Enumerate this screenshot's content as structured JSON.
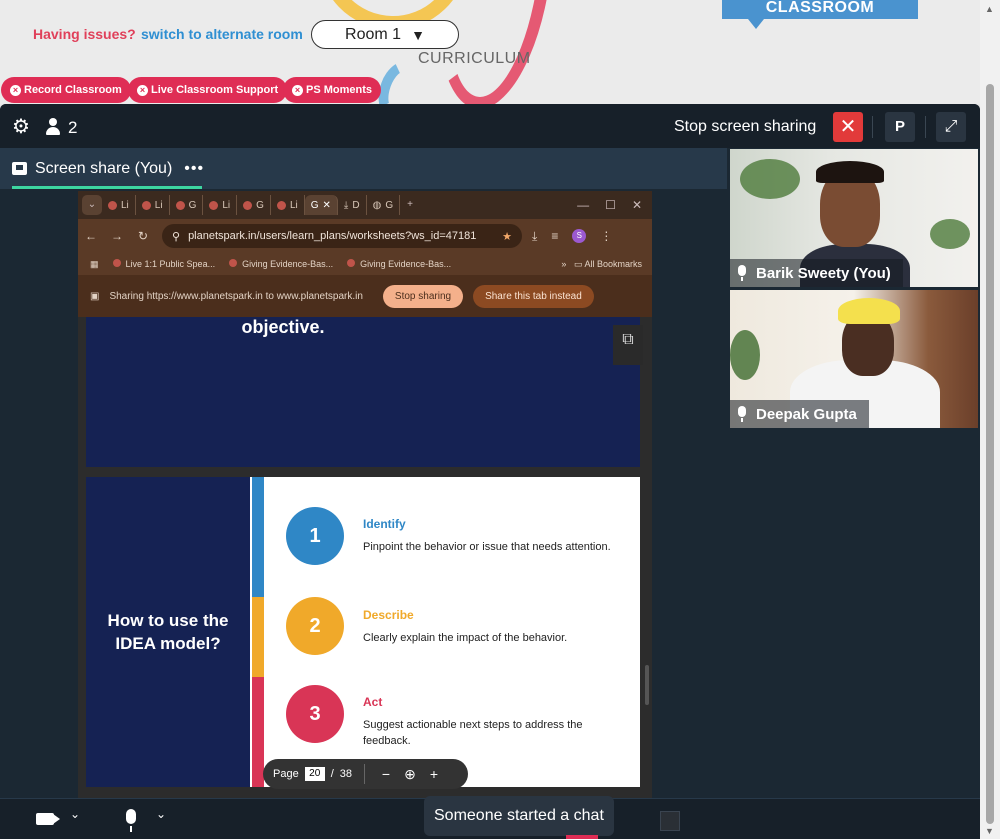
{
  "header": {
    "classroom_tab": "CLASSROOM",
    "issues_text": "Having issues?",
    "switch_room_link": "switch to alternate room",
    "room_select_value": "Room 1",
    "curriculum_label": "CURRICULUM",
    "colors": {
      "accent_red": "#df2d55",
      "link_blue": "#2f8fd2",
      "tab_blue": "#4a93cf"
    }
  },
  "action_buttons": [
    {
      "label": "Record Classroom"
    },
    {
      "label": "Live Classroom Support"
    },
    {
      "label": "PS Moments"
    }
  ],
  "meeting": {
    "participant_count": "2",
    "stop_sharing_label": "Stop screen sharing",
    "p_button_label": "P",
    "share_tab_label": "Screen share (You)",
    "share_tab_more": "•••"
  },
  "shared_screen": {
    "tabs": [
      {
        "label": "Li"
      },
      {
        "label": "Li"
      },
      {
        "label": "G"
      },
      {
        "label": "Li"
      },
      {
        "label": "G"
      },
      {
        "label": "Li"
      },
      {
        "label": "G",
        "active": true
      },
      {
        "label": "D"
      },
      {
        "label": "G"
      }
    ],
    "url": "planetspark.in/users/learn_plans/worksheets?ws_id=47181",
    "profile_initial": "S",
    "bookmarks": [
      "Live 1:1 Public Spea...",
      "Giving Evidence-Bas...",
      "Giving Evidence-Bas..."
    ],
    "all_bookmarks": "All Bookmarks",
    "sharing_message": "Sharing https://www.planetspark.in to www.planetspark.in",
    "sharing_stop_button": "Stop sharing",
    "sharing_tab_button": "Share this tab instead",
    "slide": {
      "top_heading": "objective.",
      "title": "How to use the IDEA model?",
      "steps": [
        {
          "number": "1",
          "title": "Identify",
          "description": "Pinpoint the behavior or issue that needs attention.",
          "color": "#2f87c6"
        },
        {
          "number": "2",
          "title": "Describe",
          "description": "Clearly explain the impact of the behavior.",
          "color": "#f0a92a"
        },
        {
          "number": "3",
          "title": "Act",
          "description": "Suggest actionable next steps to address the feedback.",
          "color": "#d93556"
        }
      ]
    },
    "pdf_toolbar": {
      "page_label": "Page",
      "current_page": "20",
      "separator": "/",
      "total_pages": "38"
    }
  },
  "participants": [
    {
      "name": "Barik Sweety (You)"
    },
    {
      "name": "Deepak Gupta"
    }
  ],
  "bottom_bar": {
    "chat_toast": "Someone started a chat"
  }
}
